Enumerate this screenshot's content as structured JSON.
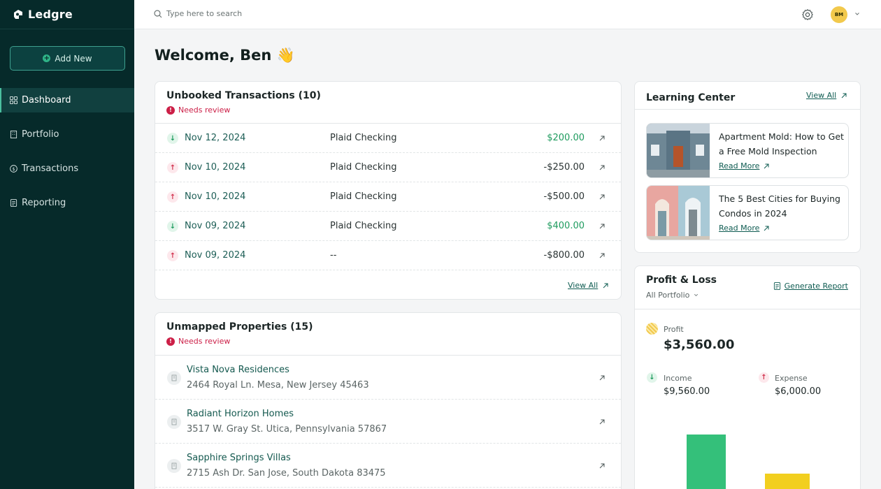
{
  "sidebar": {
    "brand": "Ledgre",
    "add_new": "Add New",
    "items": [
      {
        "label": "Dashboard",
        "active": true
      },
      {
        "label": "Portfolio"
      },
      {
        "label": "Transactions"
      },
      {
        "label": "Reporting"
      }
    ]
  },
  "topbar": {
    "search_placeholder": "Type here to search",
    "avatar_initials": "BM"
  },
  "welcome": "Welcome, Ben 👋",
  "unbooked": {
    "title": "Unbooked Transactions (10)",
    "needs_review": "Needs review",
    "rows": [
      {
        "direction": "in",
        "date": "Nov 12, 2024",
        "account": "Plaid Checking",
        "amount": "$200.00"
      },
      {
        "direction": "out",
        "date": "Nov 10, 2024",
        "account": "Plaid Checking",
        "amount": "-$250.00"
      },
      {
        "direction": "out",
        "date": "Nov 10, 2024",
        "account": "Plaid Checking",
        "amount": "-$500.00"
      },
      {
        "direction": "in",
        "date": "Nov 09, 2024",
        "account": "Plaid Checking",
        "amount": "$400.00"
      },
      {
        "direction": "out",
        "date": "Nov 09, 2024",
        "account": "--",
        "amount": "-$800.00"
      }
    ],
    "view_all": "View All"
  },
  "unmapped": {
    "title": "Unmapped Properties (15)",
    "needs_review": "Needs review",
    "rows": [
      {
        "name": "Vista Nova Residences",
        "address": "2464 Royal Ln. Mesa, New Jersey 45463"
      },
      {
        "name": "Radiant Horizon Homes",
        "address": "3517 W. Gray St. Utica, Pennsylvania 57867"
      },
      {
        "name": "Sapphire Springs Villas",
        "address": "2715 Ash Dr. San Jose, South Dakota 83475"
      }
    ]
  },
  "learning": {
    "title": "Learning Center",
    "view_all": "View All",
    "articles": [
      {
        "title": "Apartment Mold: How to Get a Free Mold Inspection",
        "read_more": "Read More"
      },
      {
        "title": "The 5 Best Cities for Buying Condos in 2024",
        "read_more": "Read More"
      }
    ]
  },
  "pl": {
    "title": "Profit & Loss",
    "filter": "All Portfolio",
    "generate_report": "Generate Report",
    "profit_label": "Profit",
    "profit_value": "$3,560.00",
    "income_label": "Income",
    "income_value": "$9,560.00",
    "expense_label": "Expense",
    "expense_value": "$6,000.00",
    "colors": {
      "income": "#34c07a",
      "expense": "#f2cf1f"
    }
  }
}
